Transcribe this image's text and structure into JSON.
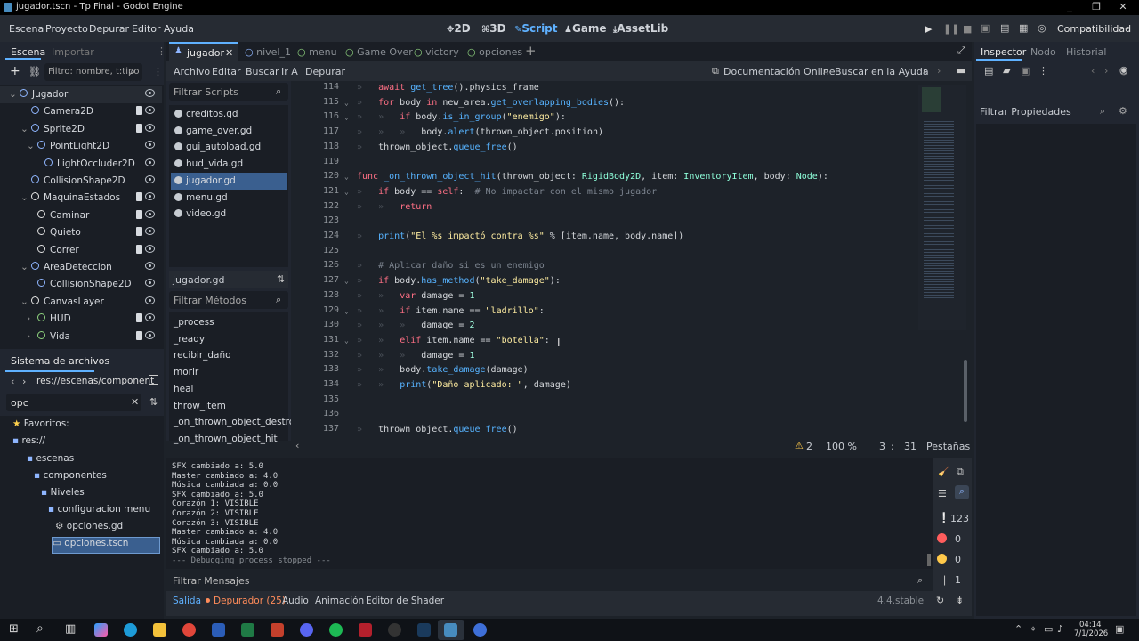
{
  "window": {
    "title": "jugador.tscn - Tp Final - Godot Engine",
    "controls": [
      "_",
      "❐",
      "✕"
    ]
  },
  "menu": {
    "items": [
      "Escena",
      "Proyecto",
      "Depurar",
      "Editor",
      "Ayuda"
    ]
  },
  "workspaces": {
    "items": [
      "2D",
      "3D",
      "Script",
      "Game",
      "AssetLib"
    ],
    "active": "Script"
  },
  "renderer": "Compatibilidad",
  "scene_dock": {
    "tabs": [
      "Escena",
      "Importar"
    ],
    "filter_placeholder": "Filtro: nombre, t:tipo",
    "nodes": [
      {
        "name": "Jugador",
        "icon": "character-icon"
      },
      {
        "name": "Camera2D",
        "icon": "camera-icon"
      },
      {
        "name": "Sprite2D",
        "icon": "sprite-icon"
      },
      {
        "name": "PointLight2D",
        "icon": "light-icon"
      },
      {
        "name": "LightOccluder2D",
        "icon": "occluder-icon"
      },
      {
        "name": "CollisionShape2D",
        "icon": "collision-icon"
      },
      {
        "name": "MaquinaEstados",
        "icon": "node-icon"
      },
      {
        "name": "Caminar",
        "icon": "node-icon"
      },
      {
        "name": "Quieto",
        "icon": "node-icon"
      },
      {
        "name": "Correr",
        "icon": "node-icon"
      },
      {
        "name": "AreaDeteccion",
        "icon": "area-icon"
      },
      {
        "name": "CollisionShape2D",
        "icon": "collision-icon"
      },
      {
        "name": "CanvasLayer",
        "icon": "canvas-icon"
      },
      {
        "name": "HUD",
        "icon": "node-icon"
      },
      {
        "name": "Vida",
        "icon": "node-icon"
      }
    ]
  },
  "filesystem": {
    "title": "Sistema de archivos",
    "path": "res://escenas/component",
    "search": "opc",
    "items": [
      {
        "label": "Favoritos:"
      },
      {
        "label": "res://"
      },
      {
        "label": "escenas"
      },
      {
        "label": "componentes"
      },
      {
        "label": "Niveles"
      },
      {
        "label": "configuracion menu"
      },
      {
        "label": "opciones.gd"
      },
      {
        "label": "opciones.tscn"
      }
    ]
  },
  "script_tabs": [
    "jugador",
    "nivel_1",
    "menu",
    "Game Over",
    "victory",
    "opciones"
  ],
  "script_menu": [
    "Archivo",
    "Editar",
    "Buscar",
    "Ir A",
    "Depurar"
  ],
  "script_toolbar": {
    "docs": "Documentación Online",
    "search_help": "Buscar en la Ayuda"
  },
  "scripts": {
    "filter": "Filtrar Scripts",
    "items": [
      "creditos.gd",
      "game_over.gd",
      "gui_autoload.gd",
      "hud_vida.gd",
      "jugador.gd",
      "menu.gd",
      "video.gd"
    ],
    "selected": "jugador.gd"
  },
  "methods": {
    "current": "jugador.gd",
    "filter": "Filtrar Métodos",
    "items": [
      "_process",
      "_ready",
      "recibir_daño",
      "morir",
      "heal",
      "throw_item",
      "_on_thrown_object_destroy",
      "_on_thrown_object_hit"
    ]
  },
  "status": {
    "warnings": "2",
    "zoom": "100 %",
    "line": "3",
    "col": "31",
    "tabs": "Pestañas"
  },
  "console": {
    "lines": [
      "SFX cambiado a: 5.0",
      "Master cambiado a: 4.0",
      "Música cambiada a: 0.0",
      "SFX cambiado a: 5.0",
      "Corazón 1: VISIBLE",
      "Corazón 2: VISIBLE",
      "Corazón 3: VISIBLE",
      "Master cambiado a: 4.0",
      "Música cambiada a: 0.0",
      "SFX cambiado a: 5.0",
      "--- Debugging process stopped ---"
    ],
    "filter": "Filtrar Mensajes",
    "counts": {
      "messages": "123",
      "errors": "0",
      "warnings": "0",
      "other": "1"
    }
  },
  "bottom_tabs": [
    "Salida",
    "Depurador (25)",
    "Audio",
    "Animación",
    "Editor de Shader"
  ],
  "version": "4.4.stable",
  "inspector": {
    "tabs": [
      "Inspector",
      "Nodo",
      "Historial"
    ],
    "filter": "Filtrar Propiedades"
  },
  "clock": {
    "time": "04:14",
    "date": "7/1/2026"
  }
}
